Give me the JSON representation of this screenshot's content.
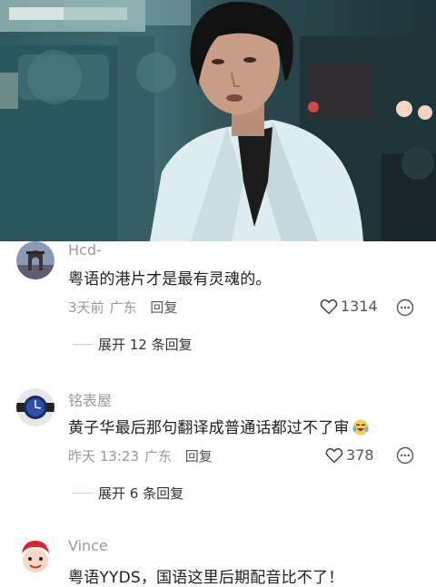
{
  "comments": [
    {
      "username": "Hcd-",
      "text": "粤语的港片才是最有灵魂的。",
      "time": "3天前",
      "location": "广东",
      "reply_label": "回复",
      "likes": "1314",
      "expand_label": "展开 12 条回复"
    },
    {
      "username": "铭表屋",
      "text": "黄子华最后那句翻译成普通话都过不了审",
      "time": "昨天 13:23",
      "location": "广东",
      "reply_label": "回复",
      "likes": "378",
      "expand_label": "展开 6 条回复"
    },
    {
      "username": "Vince",
      "text": "粤语YYDS，国语这里后期配音比不了！"
    }
  ],
  "colors": {
    "username": "#9a9a9a",
    "text": "#1f1f1f",
    "meta": "#999999",
    "accent_jacket": "#dfeff3"
  },
  "icons": {
    "like": "heart-outline-icon",
    "more": "more-dots-icon",
    "emoji": "crying-laugh-emoji"
  }
}
